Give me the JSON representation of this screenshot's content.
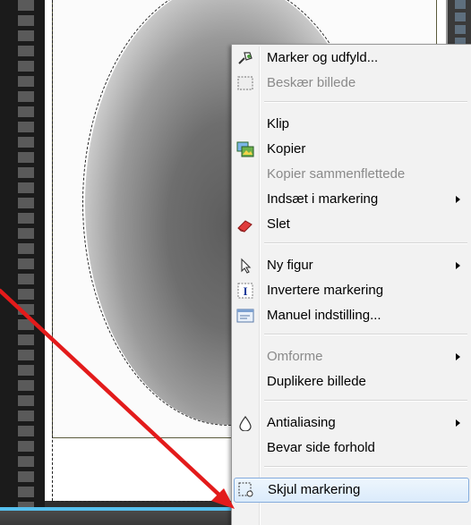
{
  "menu": {
    "items": [
      {
        "label": "Marker og udfyld...",
        "icon": "magic-select-icon",
        "enabled": true
      },
      {
        "label": "Beskær billede",
        "icon": "crop-icon",
        "enabled": false
      },
      {
        "label": "Klip",
        "icon": "",
        "enabled": true
      },
      {
        "label": "Kopier",
        "icon": "copy-image-icon",
        "enabled": true
      },
      {
        "label": "Kopier sammenflettede",
        "icon": "",
        "enabled": false
      },
      {
        "label": "Indsæt i markering",
        "icon": "",
        "enabled": true,
        "submenu": true
      },
      {
        "label": "Slet",
        "icon": "eraser-icon",
        "enabled": true
      },
      {
        "label": "Ny figur",
        "icon": "pointer-icon",
        "enabled": true,
        "submenu": true
      },
      {
        "label": "Invertere markering",
        "icon": "invert-selection-icon",
        "enabled": true
      },
      {
        "label": "Manuel indstilling...",
        "icon": "manual-settings-icon",
        "enabled": true
      },
      {
        "label": "Omforme",
        "icon": "",
        "enabled": false,
        "submenu": true
      },
      {
        "label": "Duplikere billede",
        "icon": "",
        "enabled": true
      },
      {
        "label": "Antialiasing",
        "icon": "drop-icon",
        "enabled": true,
        "submenu": true
      },
      {
        "label": "Bevar side forhold",
        "icon": "",
        "enabled": true
      },
      {
        "label": "Skjul markering",
        "icon": "hide-selection-icon",
        "enabled": true,
        "highlighted": true
      }
    ]
  },
  "colors": {
    "annotation_arrow": "#e31b1b",
    "menu_background": "#f2f2f2",
    "highlight_border": "#84acdd",
    "accent_bar": "#56c0ee"
  }
}
